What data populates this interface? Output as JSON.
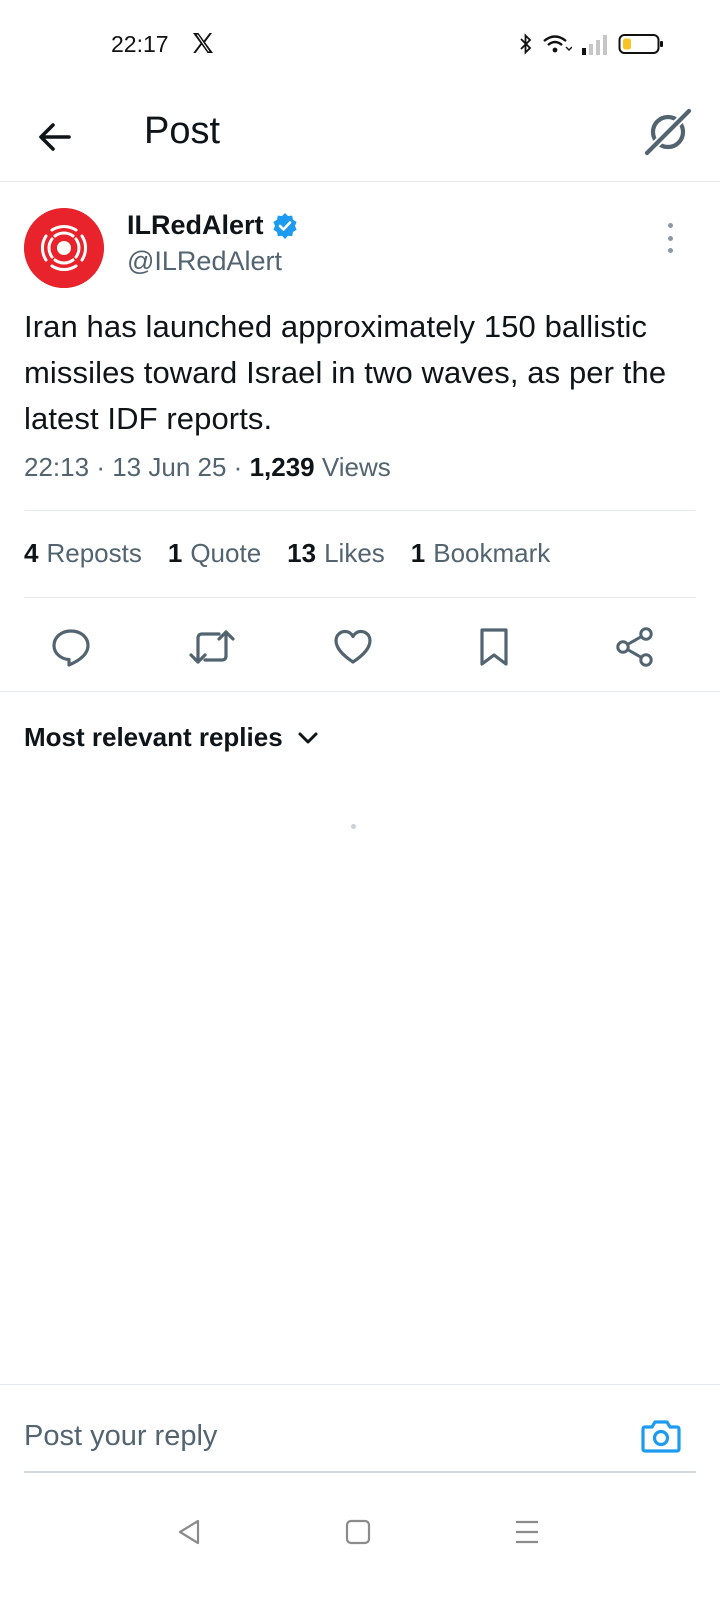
{
  "status_bar": {
    "time": "22:17",
    "app_icon": "x-logo-icon",
    "icons": [
      "bluetooth-icon",
      "wifi-icon",
      "signal-icon",
      "battery-icon"
    ],
    "battery_level": 0.25
  },
  "header": {
    "title": "Post",
    "back_icon": "back-arrow-icon",
    "action_icon": "grok-icon"
  },
  "post": {
    "author_name": "ILRedAlert",
    "author_verified": true,
    "author_handle": "@ILRedAlert",
    "text": "Iran has launched approximately 150 ballistic missiles toward Israel in two waves, as per the latest IDF reports.",
    "time": "22:13",
    "date": "13 Jun 25",
    "sep": "·",
    "views_count": "1,239",
    "views_label": "Views"
  },
  "stats": [
    {
      "count": "4",
      "label": "Reposts"
    },
    {
      "count": "1",
      "label": "Quote"
    },
    {
      "count": "13",
      "label": "Likes"
    },
    {
      "count": "1",
      "label": "Bookmark"
    }
  ],
  "actions": [
    "reply-icon",
    "repost-icon",
    "like-icon",
    "bookmark-icon",
    "share-icon"
  ],
  "replies": {
    "sort_label": "Most relevant replies"
  },
  "reply_bar": {
    "placeholder": "Post your reply"
  },
  "nav": [
    "back-triangle-icon",
    "home-square-icon",
    "menu-lines-icon"
  ],
  "colors": {
    "accent_blue": "#1d9bf0",
    "text_primary": "#0f1419",
    "text_secondary": "#536471",
    "avatar_red": "#e8232b",
    "battery_yellow": "#f7c325"
  }
}
